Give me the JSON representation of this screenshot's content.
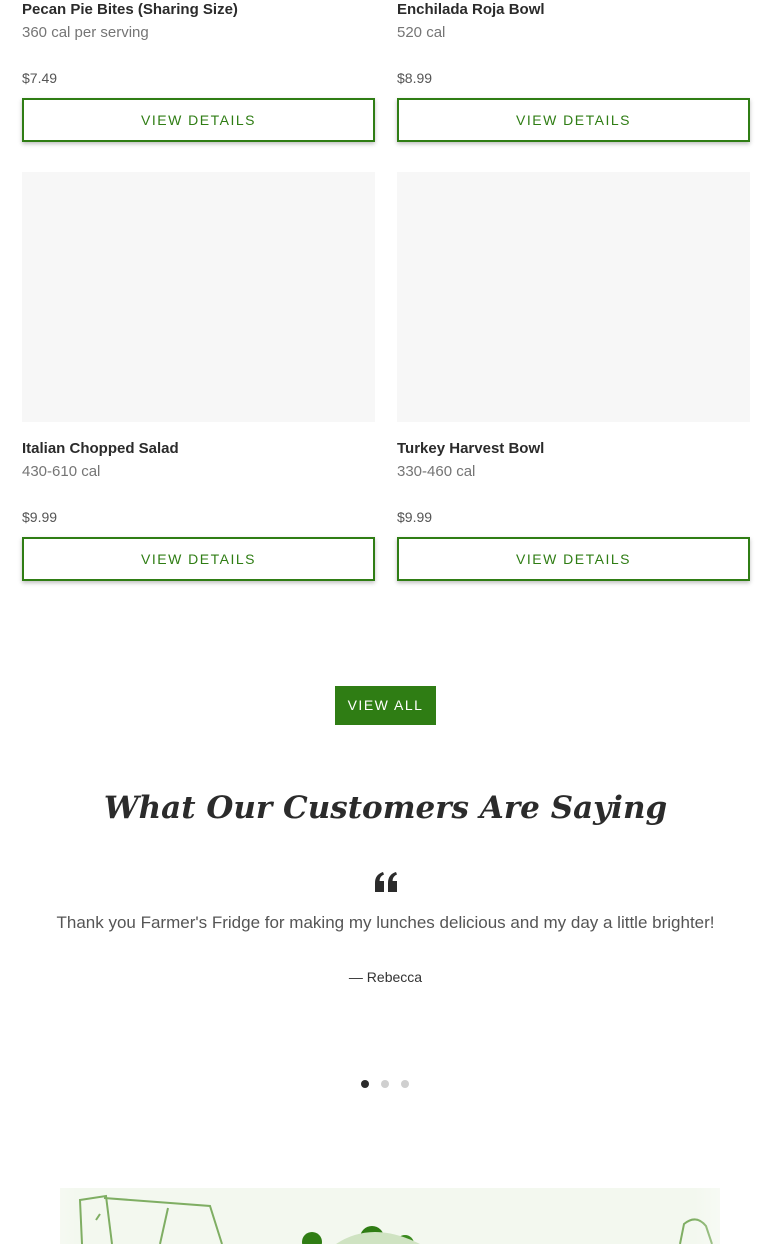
{
  "products": [
    {
      "name": "Pecan Pie Bites (Sharing Size)",
      "calories": "360 cal per serving",
      "price": "$7.49",
      "button_label": "VIEW DETAILS"
    },
    {
      "name": "Enchilada Roja Bowl",
      "calories": "520 cal",
      "price": "$8.99",
      "button_label": "VIEW DETAILS"
    },
    {
      "name": "Italian Chopped Salad",
      "calories": "430-610 cal",
      "price": "$9.99",
      "button_label": "VIEW DETAILS"
    },
    {
      "name": "Turkey Harvest Bowl",
      "calories": "330-460 cal",
      "price": "$9.99",
      "button_label": "VIEW DETAILS"
    }
  ],
  "view_all_label": "VIEW ALL",
  "testimonials": {
    "heading": "What Our Customers Are Saying",
    "quote": "Thank you Farmer's Fridge for making my lunches delicious and my day a little brighter!",
    "author": "— Rebecca",
    "slide_count": 3,
    "active_slide": 1
  },
  "colors": {
    "accent_green": "#2f7d14",
    "image_placeholder": "#f7f7f7"
  }
}
